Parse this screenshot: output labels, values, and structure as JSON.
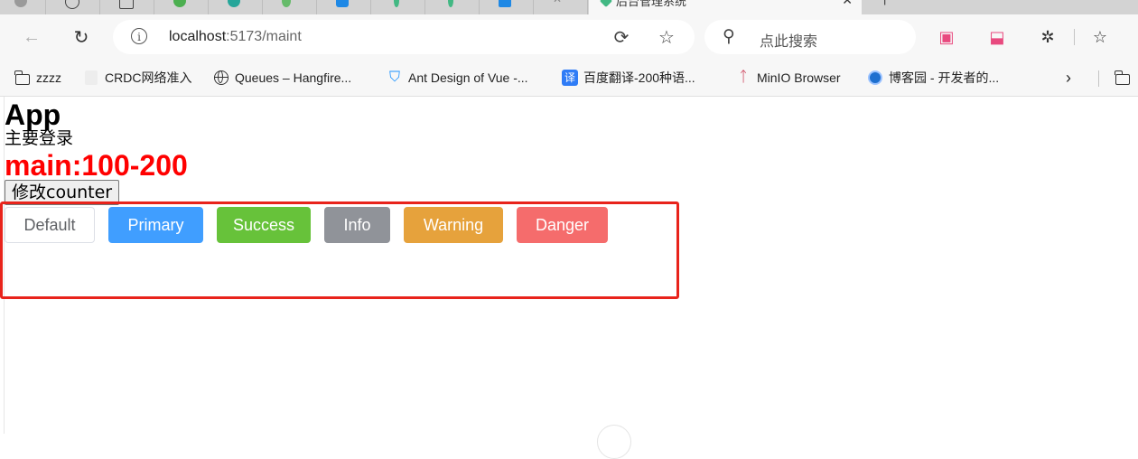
{
  "browser": {
    "active_tab_title": "后台管理系统",
    "address_host": "localhost",
    "address_path": ":5173/maint",
    "search_placeholder": "点此搜索"
  },
  "bookmarks": [
    {
      "label": "zzzz",
      "icon": "folder-icon"
    },
    {
      "label": "CRDC网络准入",
      "icon": "page-icon"
    },
    {
      "label": "Queues – Hangfire...",
      "icon": "globe-icon"
    },
    {
      "label": "Ant Design of Vue -...",
      "icon": "antd-icon"
    },
    {
      "label": "百度翻译-200种语...",
      "icon": "translate-icon"
    },
    {
      "label": "MinIO Browser",
      "icon": "minio-icon"
    },
    {
      "label": "博客园 - 开发者的...",
      "icon": "cnblogs-icon"
    }
  ],
  "page": {
    "app_title": "App",
    "subtitle": "主要登录",
    "main_range": "main:100-200",
    "modify_button": "修改counter",
    "buttons": [
      {
        "label": "Default",
        "type": "default",
        "color": "#ffffff"
      },
      {
        "label": "Primary",
        "type": "primary",
        "color": "#409eff"
      },
      {
        "label": "Success",
        "type": "success",
        "color": "#67c23a"
      },
      {
        "label": "Info",
        "type": "info",
        "color": "#909399"
      },
      {
        "label": "Warning",
        "type": "warning",
        "color": "#e6a23c"
      },
      {
        "label": "Danger",
        "type": "danger",
        "color": "#f56c6c"
      }
    ]
  },
  "colors": {
    "highlight": "#e8231b",
    "main_range_text": "#ff0000"
  }
}
